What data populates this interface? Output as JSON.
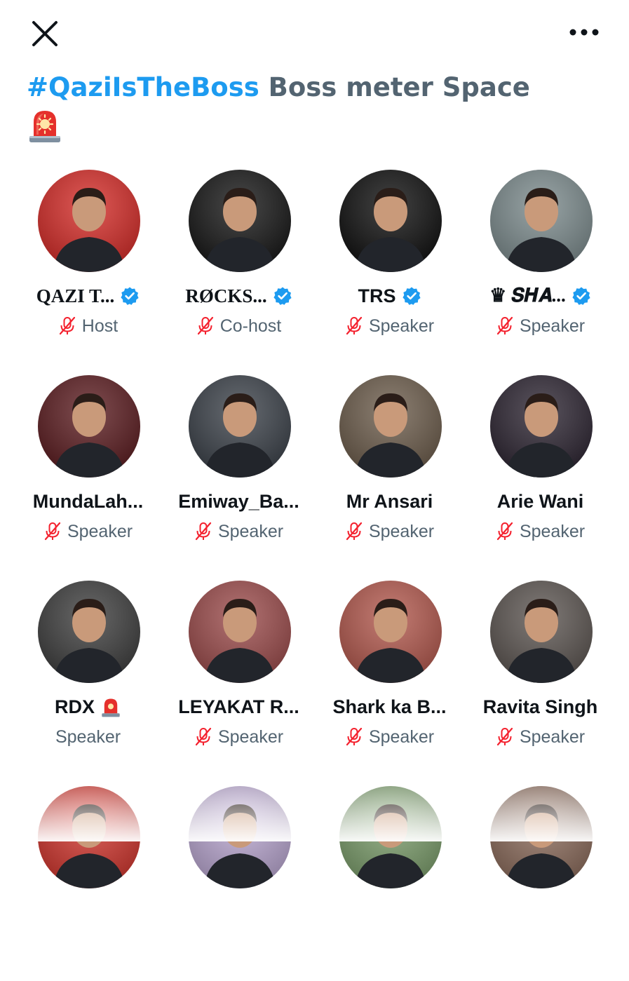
{
  "header": {
    "close_icon": "close-icon",
    "more_icon": "more-horizontal-icon"
  },
  "space": {
    "hashtag": "#QaziIsTheBoss",
    "title_rest": " Boss meter Space",
    "emoji_icon": "siren-icon"
  },
  "colors": {
    "accent": "#1d9bf0",
    "muted": "#536471",
    "text": "#0f1419",
    "mic_off": "#f4212e"
  },
  "participants": [
    {
      "name": "QAZI T...",
      "verified": true,
      "role": "Host",
      "muted": true,
      "avatar_bg": "#d42a26"
    },
    {
      "name": "RØCKS...",
      "verified": true,
      "role": "Co-host",
      "muted": true,
      "avatar_bg": "#141414"
    },
    {
      "name": "TRS",
      "verified": true,
      "role": "Speaker",
      "muted": true,
      "avatar_bg": "#0d0d0d"
    },
    {
      "name": "♛ 𝑺𝑯𝑨...",
      "verified": true,
      "role": "Speaker",
      "muted": true,
      "avatar_bg": "#7b8a8c"
    },
    {
      "name": "MundaLah...",
      "verified": false,
      "role": "Speaker",
      "muted": true,
      "avatar_bg": "#5a1a1e"
    },
    {
      "name": "Emiway_Ba...",
      "verified": false,
      "role": "Speaker",
      "muted": true,
      "avatar_bg": "#3a4048"
    },
    {
      "name": "Mr Ansari",
      "verified": false,
      "role": "Speaker",
      "muted": true,
      "avatar_bg": "#6b5b4a"
    },
    {
      "name": "Arie Wani",
      "verified": false,
      "role": "Speaker",
      "muted": true,
      "avatar_bg": "#2b2330"
    },
    {
      "name": "RDX",
      "verified": false,
      "role": "Speaker",
      "muted": false,
      "emoji": "siren-icon",
      "avatar_bg": "#3c3c3c"
    },
    {
      "name": "LEYAKAT R...",
      "verified": false,
      "role": "Speaker",
      "muted": true,
      "avatar_bg": "#9b4a4a"
    },
    {
      "name": "Shark ka B...",
      "verified": false,
      "role": "Speaker",
      "muted": true,
      "avatar_bg": "#b2574c"
    },
    {
      "name": "Ravita Singh",
      "verified": false,
      "role": "Speaker",
      "muted": true,
      "avatar_bg": "#5b5450"
    }
  ],
  "partial_row": [
    {
      "avatar_bg": "#d0342c"
    },
    {
      "avatar_bg": "#b8a5cf"
    },
    {
      "avatar_bg": "#7a9c6a"
    },
    {
      "avatar_bg": "#8a6a5a"
    }
  ]
}
